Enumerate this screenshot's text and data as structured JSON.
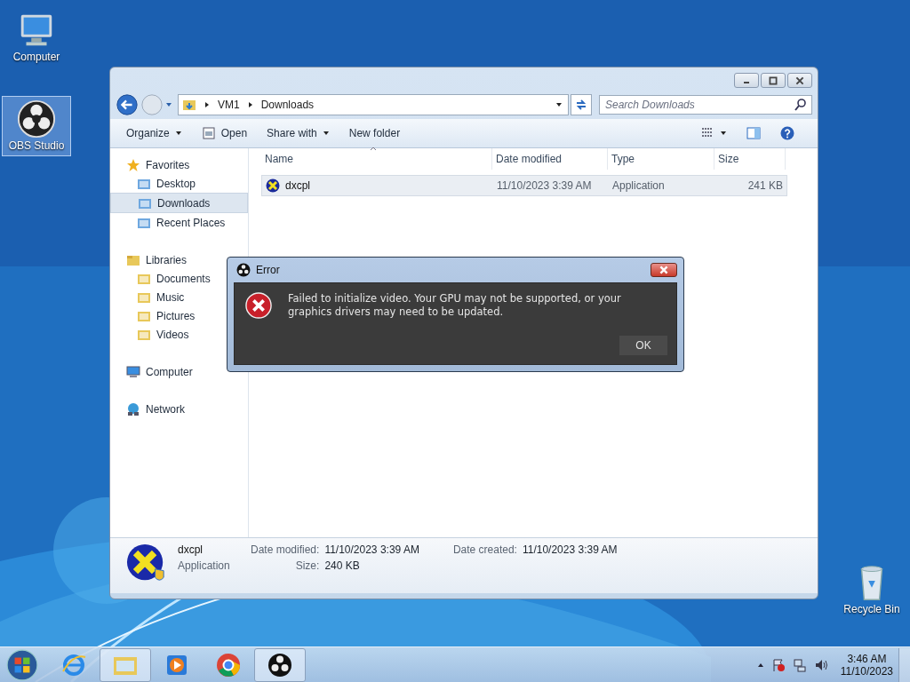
{
  "desktop_icons": [
    {
      "label": "Computer",
      "selected": false
    },
    {
      "label": "OBS Studio",
      "selected": true
    }
  ],
  "recycle_bin": {
    "label": "Recycle Bin"
  },
  "explorer": {
    "breadcrumb": [
      "VM1",
      "Downloads"
    ],
    "search": {
      "placeholder": "Search Downloads"
    },
    "toolbar": [
      {
        "label": "Organize",
        "dropdown": true
      },
      {
        "label": "Open",
        "dropdown": false
      },
      {
        "label": "Share with",
        "dropdown": true
      },
      {
        "label": "New folder",
        "dropdown": false
      }
    ],
    "nav": [
      {
        "label": "Favorites",
        "selected": false,
        "children": [
          {
            "label": "Desktop",
            "selected": false
          },
          {
            "label": "Downloads",
            "selected": true
          },
          {
            "label": "Recent Places",
            "selected": false
          }
        ]
      },
      {
        "label": "Libraries",
        "selected": false,
        "children": [
          {
            "label": "Documents",
            "selected": false
          },
          {
            "label": "Music",
            "selected": false
          },
          {
            "label": "Pictures",
            "selected": false
          },
          {
            "label": "Videos",
            "selected": false
          }
        ]
      },
      {
        "label": "Computer",
        "selected": false
      },
      {
        "label": "Network",
        "selected": false
      }
    ],
    "columns": [
      "Name",
      "Date modified",
      "Type",
      "Size"
    ],
    "rows": [
      {
        "name": "dxcpl",
        "date_modified": "11/10/2023 3:39 AM",
        "type": "Application",
        "size": "241 KB",
        "selected": true
      }
    ],
    "details": {
      "name": "dxcpl",
      "type": "Application",
      "fields": [
        {
          "label": "Date modified:",
          "value": "11/10/2023 3:39 AM"
        },
        {
          "label": "Size:",
          "value": "240 KB"
        },
        {
          "label": "Date created:",
          "value": "11/10/2023 3:39 AM"
        }
      ]
    }
  },
  "dialog": {
    "title": "Error",
    "message": "Failed to initialize video.  Your GPU may not be supported, or your graphics drivers may need to be updated.",
    "button": "OK"
  },
  "taskbar": {
    "apps": [
      {
        "selected": false
      },
      {
        "selected": true
      },
      {
        "selected": false
      },
      {
        "selected": false
      },
      {
        "selected": true
      }
    ],
    "time": "3:46 AM",
    "date": "11/10/2023"
  }
}
